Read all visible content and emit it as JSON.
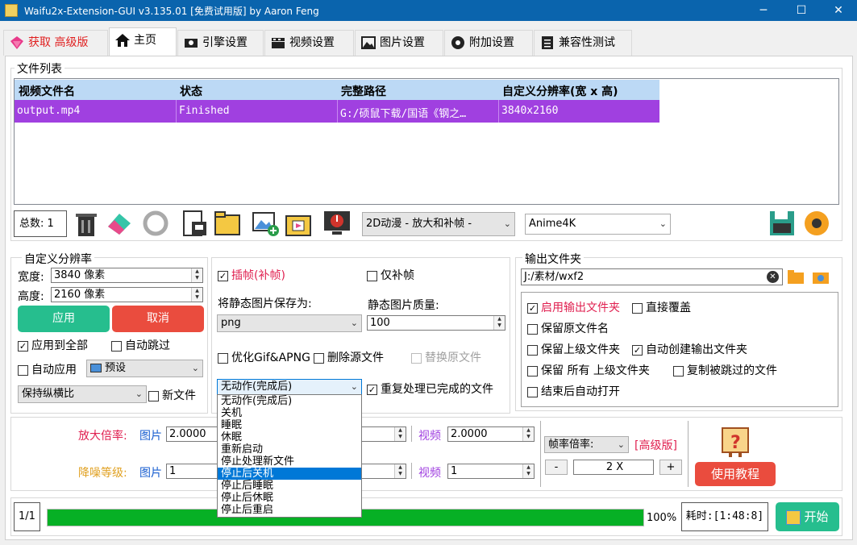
{
  "window": {
    "title": "Waifu2x-Extension-GUI v3.135.01 [免费试用版] by Aaron Feng",
    "min_glyph": "─",
    "max_glyph": "☐",
    "close_glyph": "✕"
  },
  "tabs": [
    {
      "label": "获取 高级版",
      "icon": "diamond-icon"
    },
    {
      "label": "主页",
      "icon": "home-icon"
    },
    {
      "label": "引擎设置",
      "icon": "engine-icon"
    },
    {
      "label": "视频设置",
      "icon": "clapperboard-icon"
    },
    {
      "label": "图片设置",
      "icon": "picture-icon"
    },
    {
      "label": "附加设置",
      "icon": "gear-icon"
    },
    {
      "label": "兼容性测试",
      "icon": "checklist-icon"
    }
  ],
  "file_list": {
    "group_label": "文件列表",
    "columns": [
      "视频文件名",
      "状态",
      "完整路径",
      "自定义分辨率(宽 x 高)"
    ],
    "rows": [
      [
        "output.mp4",
        "Finished",
        "G:/硕鼠下载/国语《钢之…",
        "3840x2160"
      ]
    ],
    "total_label": "总数: 1",
    "model_combo": "2D动漫 - 放大和补帧 -",
    "engine_combo": "Anime4K"
  },
  "resolution": {
    "group_label": "自定义分辨率",
    "width_label": "宽度:",
    "width_value": "3840 像素",
    "height_label": "高度:",
    "height_value": "2160 像素",
    "apply_button": "应用",
    "cancel_button": "取消",
    "apply_all": "应用到全部",
    "auto_skip": "自动跳过",
    "auto_apply": "自动应用",
    "preset_combo": "预设",
    "aspect_combo": "保持纵横比",
    "new_file": "新文件"
  },
  "middle": {
    "frame_interp": "插帧(补帧)",
    "frame_interp_only": "仅补帧",
    "save_as_label": "将静态图片保存为:",
    "save_as_value": "png",
    "quality_label": "静态图片质量:",
    "quality_value": "100",
    "optimize_gif": "优化Gif&APNG",
    "delete_source": "删除源文件",
    "replace_source": "替换原文件",
    "after_action": "无动作(完成后)",
    "reprocess": "重复处理已完成的文件",
    "after_options": [
      "无动作(完成后)",
      "关机",
      "睡眠",
      "休眠",
      "重新启动",
      "停止处理新文件",
      "停止后关机",
      "停止后睡眠",
      "停止后休眠",
      "停止后重启"
    ],
    "after_selected_index": 6
  },
  "output": {
    "group_label": "输出文件夹",
    "path": "J:/素材/wxf2",
    "enable_output": "启用输出文件夹",
    "overwrite": "直接覆盖",
    "keep_name": "保留原文件名",
    "keep_parent": "保留上级文件夹",
    "auto_create": "自动创建输出文件夹",
    "keep_all_parent": "保留 所有 上级文件夹",
    "copy_skipped": "复制被跳过的文件",
    "auto_open": "结束后自动打开"
  },
  "scale": {
    "scale_label": "放大倍率:",
    "denoise_label": "降噪等级:",
    "image_label": "图片",
    "video_label": "视频",
    "scale_image": "2.0000",
    "scale_video": "2.0000",
    "denoise_image": "1",
    "denoise_video": "1",
    "fps_combo": "帧率倍率:",
    "premium": "[高级版]",
    "fps_value": "2 X",
    "minus": "-",
    "plus": "+",
    "tutorial_button": "使用教程"
  },
  "status": {
    "count": "1/1",
    "progress_percent": 100,
    "progress_text": "100%",
    "elapsed": "耗时:[1:48:8]",
    "start_button": "开始"
  },
  "colors": {
    "accent": "#0a64ad",
    "row_highlight": "#a040e0",
    "header_bg": "#bcd9f5",
    "green": "#26be8e",
    "red": "#ea4c3e",
    "progress": "#06b025",
    "selected_option": "#0078d7"
  }
}
